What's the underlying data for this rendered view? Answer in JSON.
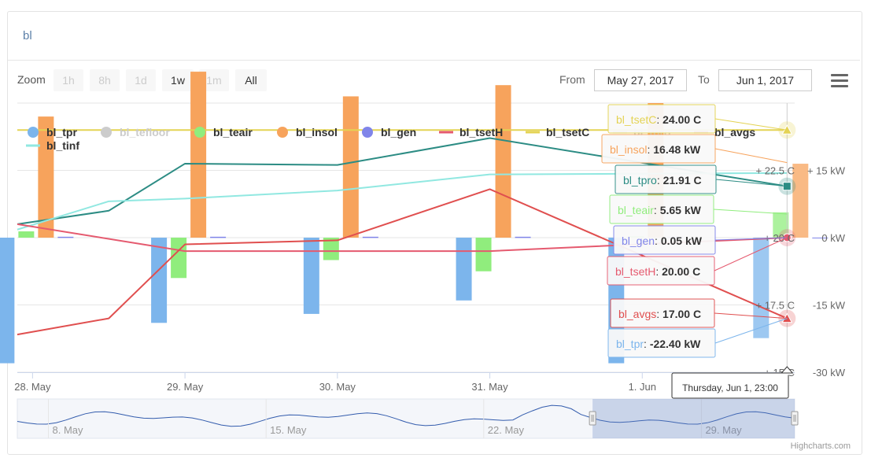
{
  "title": "bl",
  "zoom": {
    "label": "Zoom",
    "buttons": [
      "1h",
      "8h",
      "1d",
      "1w",
      "1m",
      "All"
    ],
    "enabled": [
      false,
      false,
      false,
      true,
      false,
      true
    ]
  },
  "range": {
    "from_label": "From",
    "from": "May 27, 2017",
    "to_label": "To",
    "to": "Jun 1, 2017"
  },
  "credits": "Highcharts.com",
  "chart_data": {
    "type": "bar",
    "x_ticks": [
      "28. May",
      "29. May",
      "30. May",
      "31. May",
      "1. Jun"
    ],
    "x_tick_days": [
      1,
      2,
      3,
      4,
      5
    ],
    "x_range_days": [
      0.9,
      6.0
    ],
    "y_left": {
      "ticks": [
        "+ 15 C",
        "+ 17.5 C",
        "+ 20 C",
        "+ 22.5 C"
      ],
      "range": [
        15,
        25
      ]
    },
    "y_right": {
      "ticks": [
        "-30 kW",
        "-15 kW",
        "0 kW",
        "+ 15 kW"
      ],
      "range": [
        -30,
        30
      ]
    },
    "legend": [
      {
        "name": "bl_tpr",
        "color": "#7cb5ec",
        "symbol": "dot",
        "visible": true
      },
      {
        "name": "bl_tefloor",
        "color": "#cccccc",
        "symbol": "dot",
        "visible": false
      },
      {
        "name": "bl_teair",
        "color": "#90ed7d",
        "symbol": "dot",
        "visible": true
      },
      {
        "name": "bl_insol",
        "color": "#f7a35c",
        "symbol": "dot",
        "visible": true
      },
      {
        "name": "bl_gen",
        "color": "#8085e9",
        "symbol": "dot",
        "visible": true
      },
      {
        "name": "bl_tsetH",
        "color": "#e55a6f",
        "symbol": "line",
        "visible": true
      },
      {
        "name": "bl_tsetC",
        "color": "#e4d354",
        "symbol": "line",
        "visible": true
      },
      {
        "name": "bl_tpro",
        "color": "#cccccc",
        "symbol": "line",
        "visible": false
      },
      {
        "name": "bl_avgs",
        "color": "#e04f4f",
        "symbol": "line",
        "visible": true
      },
      {
        "name": "bl_tinf",
        "color": "#91e8e1",
        "symbol": "line",
        "visible": true
      }
    ],
    "bar_series": [
      {
        "name": "bl_tpr",
        "color": "#7cb5ec",
        "days": [
          1,
          2,
          3,
          4,
          5,
          5.95
        ],
        "values": [
          -28,
          -19,
          -17,
          -14,
          -28,
          -22.4
        ]
      },
      {
        "name": "bl_teair",
        "color": "#90ed7d",
        "days": [
          1,
          2,
          3,
          4,
          5,
          5.95
        ],
        "values": [
          1.4,
          -9,
          -5,
          -7.5,
          0.3,
          5.65
        ]
      },
      {
        "name": "bl_insol",
        "color": "#f7a35c",
        "days": [
          1,
          2,
          3,
          4,
          5,
          5.95
        ],
        "values": [
          27,
          37,
          31.5,
          34,
          30,
          16.48
        ]
      },
      {
        "name": "bl_gen",
        "color": "#8085e9",
        "days": [
          1,
          2,
          3,
          4,
          5,
          5.95
        ],
        "values": [
          0.2,
          0.2,
          0.2,
          0.2,
          0.2,
          0.05
        ]
      }
    ],
    "line_series": [
      {
        "name": "bl_tsetC",
        "color": "#e4d354",
        "days": [
          0.9,
          5.95
        ],
        "values": [
          24,
          24
        ]
      },
      {
        "name": "bl_tpro",
        "color": "#2c8c84",
        "days": [
          0.9,
          1.5,
          2,
          3,
          4,
          5.95
        ],
        "values": [
          20.5,
          21.0,
          22.75,
          22.7,
          23.7,
          21.91
        ]
      },
      {
        "name": "bl_tinf",
        "color": "#91e8e1",
        "days": [
          0.9,
          1.5,
          2,
          3,
          4,
          5.95
        ],
        "values": [
          20.3,
          21.35,
          21.45,
          21.75,
          22.35,
          22.4
        ]
      },
      {
        "name": "bl_tsetH",
        "color": "#e55a6f",
        "days": [
          0.9,
          2,
          3,
          4,
          5.95
        ],
        "values": [
          20.5,
          19.5,
          19.5,
          19.5,
          20.0
        ]
      },
      {
        "name": "bl_avgs",
        "color": "#e04f4f",
        "days": [
          0.9,
          1.5,
          2,
          3,
          4,
          5.95
        ],
        "values": [
          16.4,
          17.0,
          19.75,
          19.9,
          21.8,
          17.0
        ]
      }
    ],
    "tooltips": [
      {
        "name": "bl_tsetC",
        "value": "24.00 C",
        "color": "#e4d354"
      },
      {
        "name": "bl_insol",
        "value": "16.48 kW",
        "color": "#f7a35c"
      },
      {
        "name": "bl_tpro",
        "value": "21.91 C",
        "color": "#2c8c84"
      },
      {
        "name": "bl_teair",
        "value": "5.65 kW",
        "color": "#90ed7d"
      },
      {
        "name": "bl_gen",
        "value": "0.05 kW",
        "color": "#8085e9"
      },
      {
        "name": "bl_tsetH",
        "value": "20.00 C",
        "color": "#e55a6f"
      },
      {
        "name": "bl_avgs",
        "value": "17.00 C",
        "color": "#e04f4f"
      },
      {
        "name": "bl_tpr",
        "value": "-22.40 kW",
        "color": "#7cb5ec"
      }
    ],
    "crosshair_label": "Thursday, Jun 1, 23:00",
    "navigator": {
      "labels": [
        "8. May",
        "15. May",
        "22. May",
        "29. May"
      ],
      "selected_from_day": -0.5,
      "selected_to_day": 6.0
    }
  }
}
